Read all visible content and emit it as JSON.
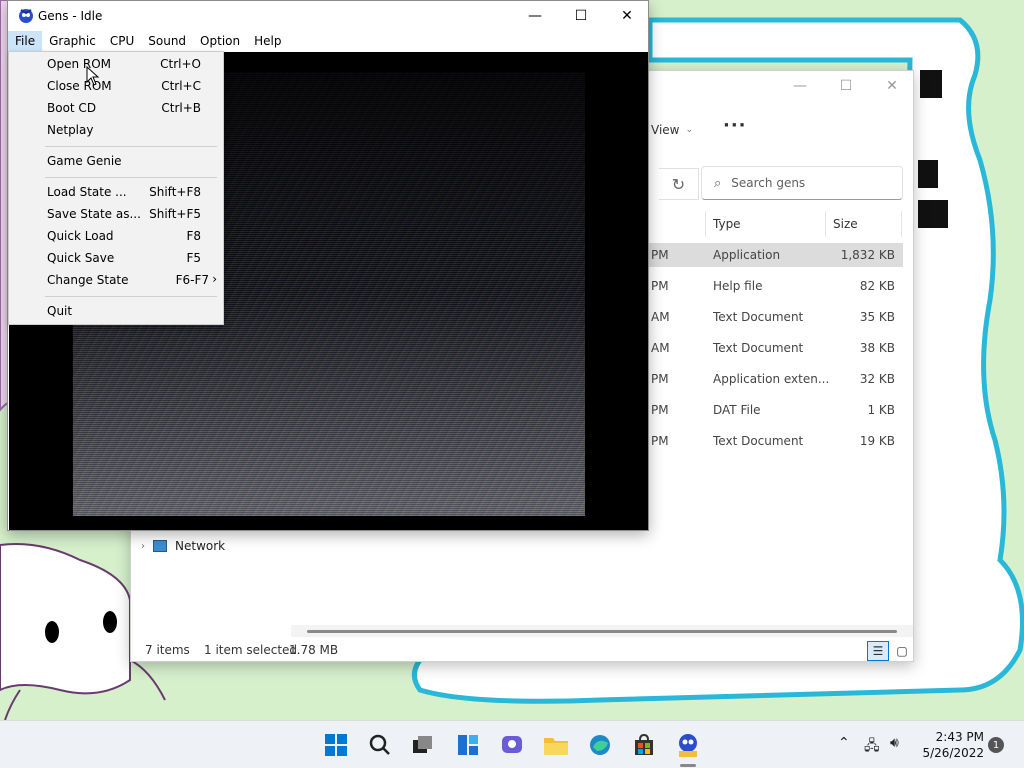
{
  "gens": {
    "title": "Gens - Idle",
    "menubar": [
      "File",
      "Graphic",
      "CPU",
      "Sound",
      "Option",
      "Help"
    ],
    "file_menu": [
      {
        "label": "Open ROM",
        "shortcut": "Ctrl+O"
      },
      {
        "label": "Close ROM",
        "shortcut": "Ctrl+C"
      },
      {
        "label": "Boot CD",
        "shortcut": "Ctrl+B"
      },
      {
        "label": "Netplay",
        "shortcut": ""
      },
      {
        "label": "Game Genie",
        "shortcut": ""
      },
      {
        "label": "Load State ...",
        "shortcut": "Shift+F8"
      },
      {
        "label": "Save State as...",
        "shortcut": "Shift+F5"
      },
      {
        "label": "Quick Load",
        "shortcut": "F8"
      },
      {
        "label": "Quick Save",
        "shortcut": "F5"
      },
      {
        "label": "Change State",
        "shortcut": "F6-F7"
      },
      {
        "label": "Quit",
        "shortcut": ""
      }
    ]
  },
  "explorer": {
    "view_label": "View",
    "search_placeholder": "Search gens",
    "columns": {
      "type": "Type",
      "size": "Size"
    },
    "rows": [
      {
        "date": "PM",
        "type": "Application",
        "size": "1,832 KB",
        "selected": true
      },
      {
        "date": "PM",
        "type": "Help file",
        "size": "82 KB"
      },
      {
        "date": "AM",
        "type": "Text Document",
        "size": "35 KB"
      },
      {
        "date": "AM",
        "type": "Text Document",
        "size": "38 KB"
      },
      {
        "date": "PM",
        "type": "Application exten...",
        "size": "32 KB"
      },
      {
        "date": "PM",
        "type": "DAT File",
        "size": "1 KB"
      },
      {
        "date": "PM",
        "type": "Text Document",
        "size": "19 KB"
      }
    ],
    "nav_network": "Network",
    "status": {
      "items": "7 items",
      "selected": "1 item selected",
      "size": "1.78 MB"
    }
  },
  "taskbar": {
    "time": "2:43 PM",
    "date": "5/26/2022",
    "notifications": "1"
  },
  "colors": {
    "accent": "#0078d4",
    "wallpaper": "#d6f0cc",
    "blob_border": "#2ab8d8"
  },
  "icons": [
    "windows-start-icon",
    "search-icon",
    "task-view-icon",
    "widgets-icon",
    "chat-icon",
    "file-explorer-icon",
    "edge-icon",
    "store-icon",
    "gens-icon"
  ]
}
